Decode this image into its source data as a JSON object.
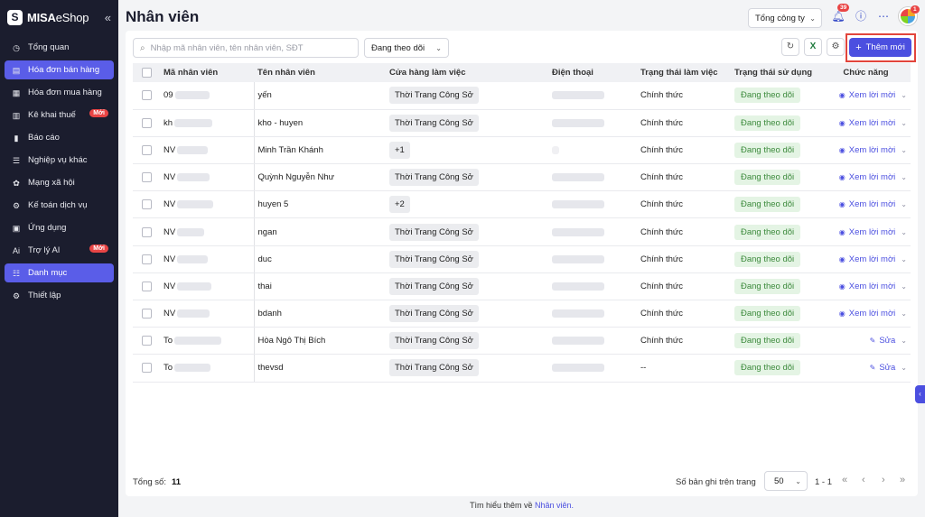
{
  "brand": {
    "logo_letter": "S",
    "name_bold": "MISA",
    "name_rest": "eShop",
    "collapse_glyph": "«"
  },
  "sidebar": {
    "items": [
      {
        "label": "Tổng quan",
        "icon": "dashboard-icon",
        "glyph": "◷",
        "active": false,
        "badge": ""
      },
      {
        "label": "Hóa đơn bán hàng",
        "icon": "invoice-icon",
        "glyph": "▤",
        "active": true,
        "badge": ""
      },
      {
        "label": "Hóa đơn mua hàng",
        "icon": "purchase-icon",
        "glyph": "▦",
        "active": false,
        "badge": ""
      },
      {
        "label": "Kê khai thuế",
        "icon": "tax-icon",
        "glyph": "▥",
        "active": false,
        "badge": "Mới"
      },
      {
        "label": "Báo cáo",
        "icon": "report-icon",
        "glyph": "▮",
        "active": false,
        "badge": ""
      },
      {
        "label": "Nghiệp vụ khác",
        "icon": "tasks-icon",
        "glyph": "☰",
        "active": false,
        "badge": ""
      },
      {
        "label": "Mạng xã hội",
        "icon": "social-icon",
        "glyph": "✿",
        "active": false,
        "badge": ""
      },
      {
        "label": "Kế toán dịch vụ",
        "icon": "accounting-icon",
        "glyph": "⚙",
        "active": false,
        "badge": ""
      },
      {
        "label": "Ứng dụng",
        "icon": "apps-icon",
        "glyph": "▣",
        "active": false,
        "badge": ""
      },
      {
        "label": "Trợ lý AI",
        "icon": "ai-icon",
        "glyph": "Ai",
        "active": false,
        "badge": "Mới"
      },
      {
        "label": "Danh mục",
        "icon": "catalog-icon",
        "glyph": "☷",
        "active": true,
        "badge": ""
      },
      {
        "label": "Thiết lập",
        "icon": "settings-icon",
        "glyph": "⚙",
        "active": false,
        "badge": ""
      }
    ]
  },
  "header": {
    "title": "Nhân viên",
    "store_select": "Tổng công ty",
    "bell_count": "39",
    "avatar_badge": "1"
  },
  "toolbar": {
    "search_placeholder": "Nhập mã nhân viên, tên nhân viên, SĐT",
    "filter_value": "Đang theo dõi",
    "add_label": "Thêm mới"
  },
  "table": {
    "columns": [
      "Mã nhân viên",
      "Tên nhân viên",
      "Cửa hàng làm việc",
      "Điện thoại",
      "Trạng thái làm việc",
      "Trạng thái sử dụng",
      "Chức năng"
    ],
    "rows": [
      {
        "code": "09",
        "name": "yến",
        "store": "Thời Trang Công Sở",
        "phone_hidden": true,
        "work": "Chính thức",
        "usage": "Đang theo dõi",
        "action": "Xem lời mời",
        "action_icon": "eye-icon",
        "chev": true
      },
      {
        "code": "kh",
        "name": "kho - huyen",
        "store": "Thời Trang Công Sở",
        "phone_hidden": true,
        "work": "Chính thức",
        "usage": "Đang theo dõi",
        "action": "Xem lời mời",
        "action_icon": "eye-icon",
        "chev": true
      },
      {
        "code": "NV",
        "name": "Minh Trần Khánh",
        "store": "+1",
        "phone_hidden": false,
        "work": "Chính thức",
        "usage": "Đang theo dõi",
        "action": "Xem lời mời",
        "action_icon": "eye-icon",
        "chev": true
      },
      {
        "code": "NV",
        "name": "Quỳnh Nguyễn Như",
        "store": "Thời Trang Công Sở",
        "phone_hidden": true,
        "work": "Chính thức",
        "usage": "Đang theo dõi",
        "action": "Xem lời mời",
        "action_icon": "eye-icon",
        "chev": true
      },
      {
        "code": "NV",
        "name": "huyen 5",
        "store": "+2",
        "phone_hidden": true,
        "work": "Chính thức",
        "usage": "Đang theo dõi",
        "action": "Xem lời mời",
        "action_icon": "eye-icon",
        "chev": true
      },
      {
        "code": "NV",
        "name": "ngan",
        "store": "Thời Trang Công Sở",
        "phone_hidden": true,
        "work": "Chính thức",
        "usage": "Đang theo dõi",
        "action": "Xem lời mời",
        "action_icon": "eye-icon",
        "chev": true
      },
      {
        "code": "NV",
        "name": "duc",
        "store": "Thời Trang Công Sở",
        "phone_hidden": true,
        "work": "Chính thức",
        "usage": "Đang theo dõi",
        "action": "Xem lời mời",
        "action_icon": "eye-icon",
        "chev": true
      },
      {
        "code": "NV",
        "name": "thai",
        "store": "Thời Trang Công Sở",
        "phone_hidden": true,
        "work": "Chính thức",
        "usage": "Đang theo dõi",
        "action": "Xem lời mời",
        "action_icon": "eye-icon",
        "chev": true
      },
      {
        "code": "NV",
        "name": "bdanh",
        "store": "Thời Trang Công Sở",
        "phone_hidden": true,
        "work": "Chính thức",
        "usage": "Đang theo dõi",
        "action": "Xem lời mời",
        "action_icon": "eye-icon",
        "chev": true
      },
      {
        "code": "To",
        "name": "Hòa Ngô Thị Bích",
        "store": "Thời Trang Công Sở",
        "phone_hidden": true,
        "work": "Chính thức",
        "usage": "Đang theo dõi",
        "action": "Sửa",
        "action_icon": "pencil-icon",
        "chev": true
      },
      {
        "code": "To",
        "name": "thevsd",
        "store": "Thời Trang Công Sở",
        "phone_hidden": true,
        "work": "--",
        "usage": "Đang theo dõi",
        "action": "Sửa",
        "action_icon": "pencil-icon",
        "chev": true
      }
    ]
  },
  "footer": {
    "total_label": "Tổng số:",
    "total_value": "11",
    "per_page_label": "Số bản ghi trên trang",
    "per_page_value": "50",
    "range": "1 - 1",
    "learn_prefix": "Tìm hiểu thêm về",
    "learn_link": "Nhân viên."
  },
  "colors": {
    "accent": "#4b4fe0",
    "sidebar_bg": "#1b1d2e",
    "status_green": "#3c8a3c",
    "highlight": "#e2453c"
  }
}
